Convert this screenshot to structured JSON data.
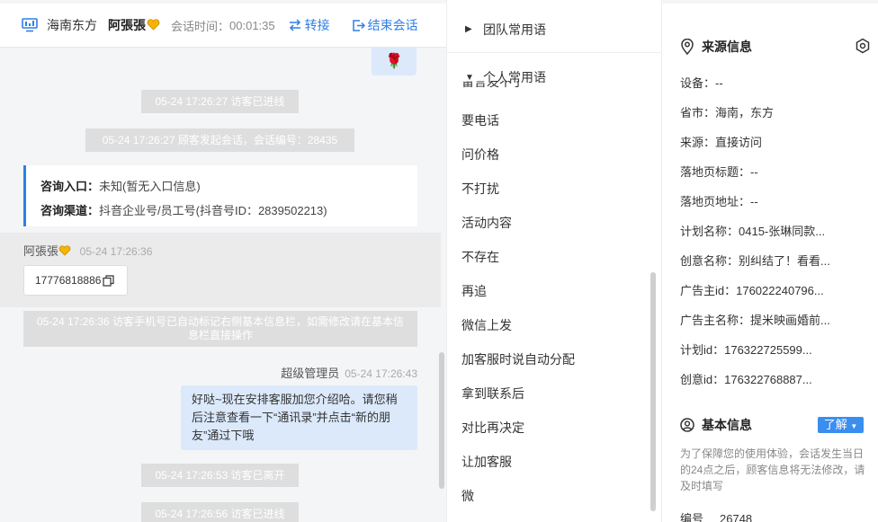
{
  "header": {
    "site": "海南东方",
    "user": "阿張張",
    "time_label": "会话时间：",
    "time_value": "00:01:35",
    "transfer": "转接",
    "end": "结束会话"
  },
  "chat": {
    "rose": "🌹",
    "sys1": "05-24 17:26:27 访客已进线",
    "sys2": "05-24 17:26:27 顾客发起会话，会话编号：28435",
    "entry_label": "咨询入口：",
    "entry_value": "未知(暂无入口信息)",
    "channel_label": "咨询渠道：",
    "channel_value": "抖音企业号/员工号(抖音号ID：2839502213)",
    "visitor_name": "阿張張",
    "visitor_time": "05-24 17:26:36",
    "visitor_phone": "17776818886",
    "sys3": "05-24 17:26:36 访客手机号已自动标记右侧基本信息栏，如需修改请在基本信息栏直接操作",
    "agent_name": "超级管理员",
    "agent_time": "05-24 17:26:43",
    "agent_msg": "好哒~现在安排客服加您介绍哈。请您稍后注意查看一下“通讯录”并点击“新的朋友”通过下哦",
    "sys4": "05-24 17:26:53 访客已离开",
    "sys5": "05-24 17:26:56 访客已进线"
  },
  "phrases": {
    "team_group": "团队常用语",
    "personal_group": "个人常用语",
    "clipped_item": "留言发不了",
    "items": [
      "要电话",
      "问价格",
      "不打扰",
      "活动内容",
      "不存在",
      "再追",
      "微信上发",
      "加客服时说自动分配",
      "拿到联系后",
      "对比再决定",
      "让加客服",
      "微"
    ]
  },
  "info": {
    "source_title": "来源信息",
    "source_rows": [
      "设备：--",
      "省市：海南，东方",
      "来源：直接访问",
      "落地页标题：--",
      "落地页地址：--",
      "计划名称：0415-张琳同款...",
      "创意名称：别纠结了！看看...",
      "广告主id：176022240796...",
      "广告主名称：提米映画婚前...",
      "计划id：176322725599...",
      "创意id：176322768887..."
    ],
    "basic_title": "基本信息",
    "learn": "了解",
    "note": "为了保障您的使用体验，会话发生当日的24点之后，顾客信息将无法修改，请及时填写",
    "id_label": "编号",
    "id_value": "26748"
  },
  "colors": {
    "accent": "#2f7fe8",
    "heart": "#f5b400",
    "bubble": "#dbe9fb",
    "system": "#dedede"
  }
}
